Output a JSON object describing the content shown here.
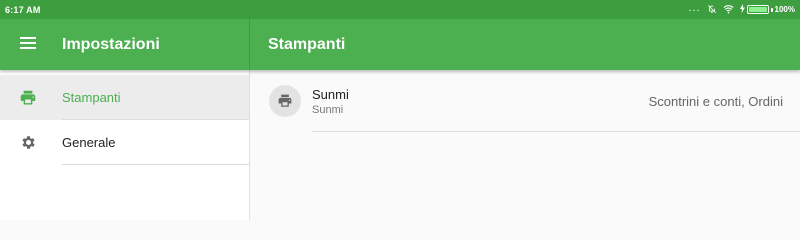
{
  "status_bar": {
    "time": "6:17 AM",
    "dots": "...",
    "battery_percent": "100%",
    "battery_level": 1.0
  },
  "appbar": {
    "left_title": "Impostazioni",
    "right_title": "Stampanti",
    "menu_icon": "menu-icon"
  },
  "colors": {
    "primary": "#4caf50",
    "status_bar": "#3d9e3f",
    "active_text": "#4caf50"
  },
  "sidebar": {
    "items": [
      {
        "label": "Stampanti",
        "icon": "printer-icon",
        "active": true
      },
      {
        "label": "Generale",
        "icon": "gear-icon",
        "active": false
      }
    ]
  },
  "printers": [
    {
      "name": "Sunmi",
      "subtitle": "Sunmi",
      "meta": "Scontrini e conti, Ordini",
      "icon": "printer-icon"
    }
  ]
}
